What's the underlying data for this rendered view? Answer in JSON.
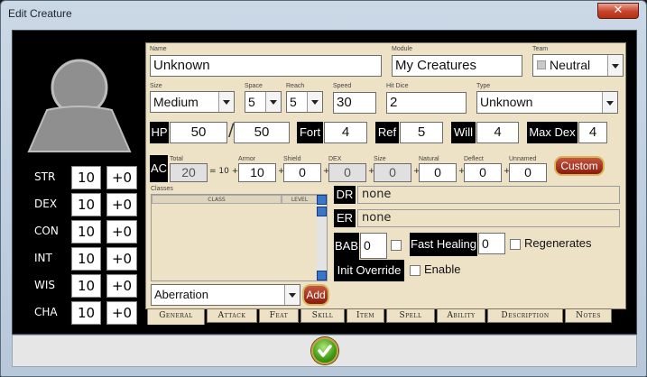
{
  "window": {
    "title": "Edit Creature",
    "close_label": "✕"
  },
  "stats": [
    {
      "name": "STR",
      "value": "10",
      "mod": "+0"
    },
    {
      "name": "DEX",
      "value": "10",
      "mod": "+0"
    },
    {
      "name": "CON",
      "value": "10",
      "mod": "+0"
    },
    {
      "name": "INT",
      "value": "10",
      "mod": "+0"
    },
    {
      "name": "WIS",
      "value": "10",
      "mod": "+0"
    },
    {
      "name": "CHA",
      "value": "10",
      "mod": "+0"
    }
  ],
  "general": {
    "name_label": "Name",
    "name_value": "Unknown",
    "module_label": "Module",
    "module_value": "My Creatures",
    "team_label": "Team",
    "team_value": "Neutral",
    "size_label": "Size",
    "size_value": "Medium",
    "space_label": "Space",
    "space_value": "5",
    "reach_label": "Reach",
    "reach_value": "5",
    "speed_label": "Speed",
    "speed_value": "30",
    "hitdice_label": "Hit Dice",
    "hitdice_value": "2",
    "type_label": "Type",
    "type_value": "Unknown",
    "hp_label": "HP",
    "hp_current": "50",
    "hp_sep": "/",
    "hp_max": "50",
    "fort_label": "Fort",
    "fort_value": "4",
    "ref_label": "Ref",
    "ref_value": "5",
    "will_label": "Will",
    "will_value": "4",
    "maxdex_label": "Max Dex",
    "maxdex_value": "4",
    "ac": {
      "label": "AC",
      "total_label": "Total",
      "total_value": "20",
      "eq_text": "= 10 +",
      "armor_label": "Armor",
      "armor_value": "10",
      "shield_label": "Shield",
      "shield_value": "0",
      "dex_label": "DEX",
      "dex_value": "0",
      "size_label": "Size",
      "size_value": "0",
      "natural_label": "Natural",
      "natural_value": "0",
      "deflect_label": "Deflect",
      "deflect_value": "0",
      "unnamed_label": "Unnamed",
      "unnamed_value": "0",
      "plus": "+",
      "custom_label": "Custom"
    },
    "classes_label": "Classes",
    "class_col": "CLASS",
    "level_col": "LEVEL",
    "class_select_value": "Aberration",
    "add_label": "Add",
    "dr_label": "DR",
    "dr_value": "none",
    "er_label": "ER",
    "er_value": "none",
    "bab_label": "BAB",
    "bab_value": "0",
    "fast_healing_label": "Fast Healing",
    "fast_healing_value": "0",
    "regenerates_label": "Regenerates",
    "init_override_label": "Init Override",
    "enable_label": "Enable"
  },
  "tabs": [
    "General",
    "Attack",
    "Feat",
    "Skill",
    "Item",
    "Spell",
    "Ability",
    "Description",
    "Notes"
  ],
  "colors": {
    "accent_red": "#8c1a0c",
    "panel_bg": "#eee2c6",
    "tab_active": "#eee2c6"
  }
}
